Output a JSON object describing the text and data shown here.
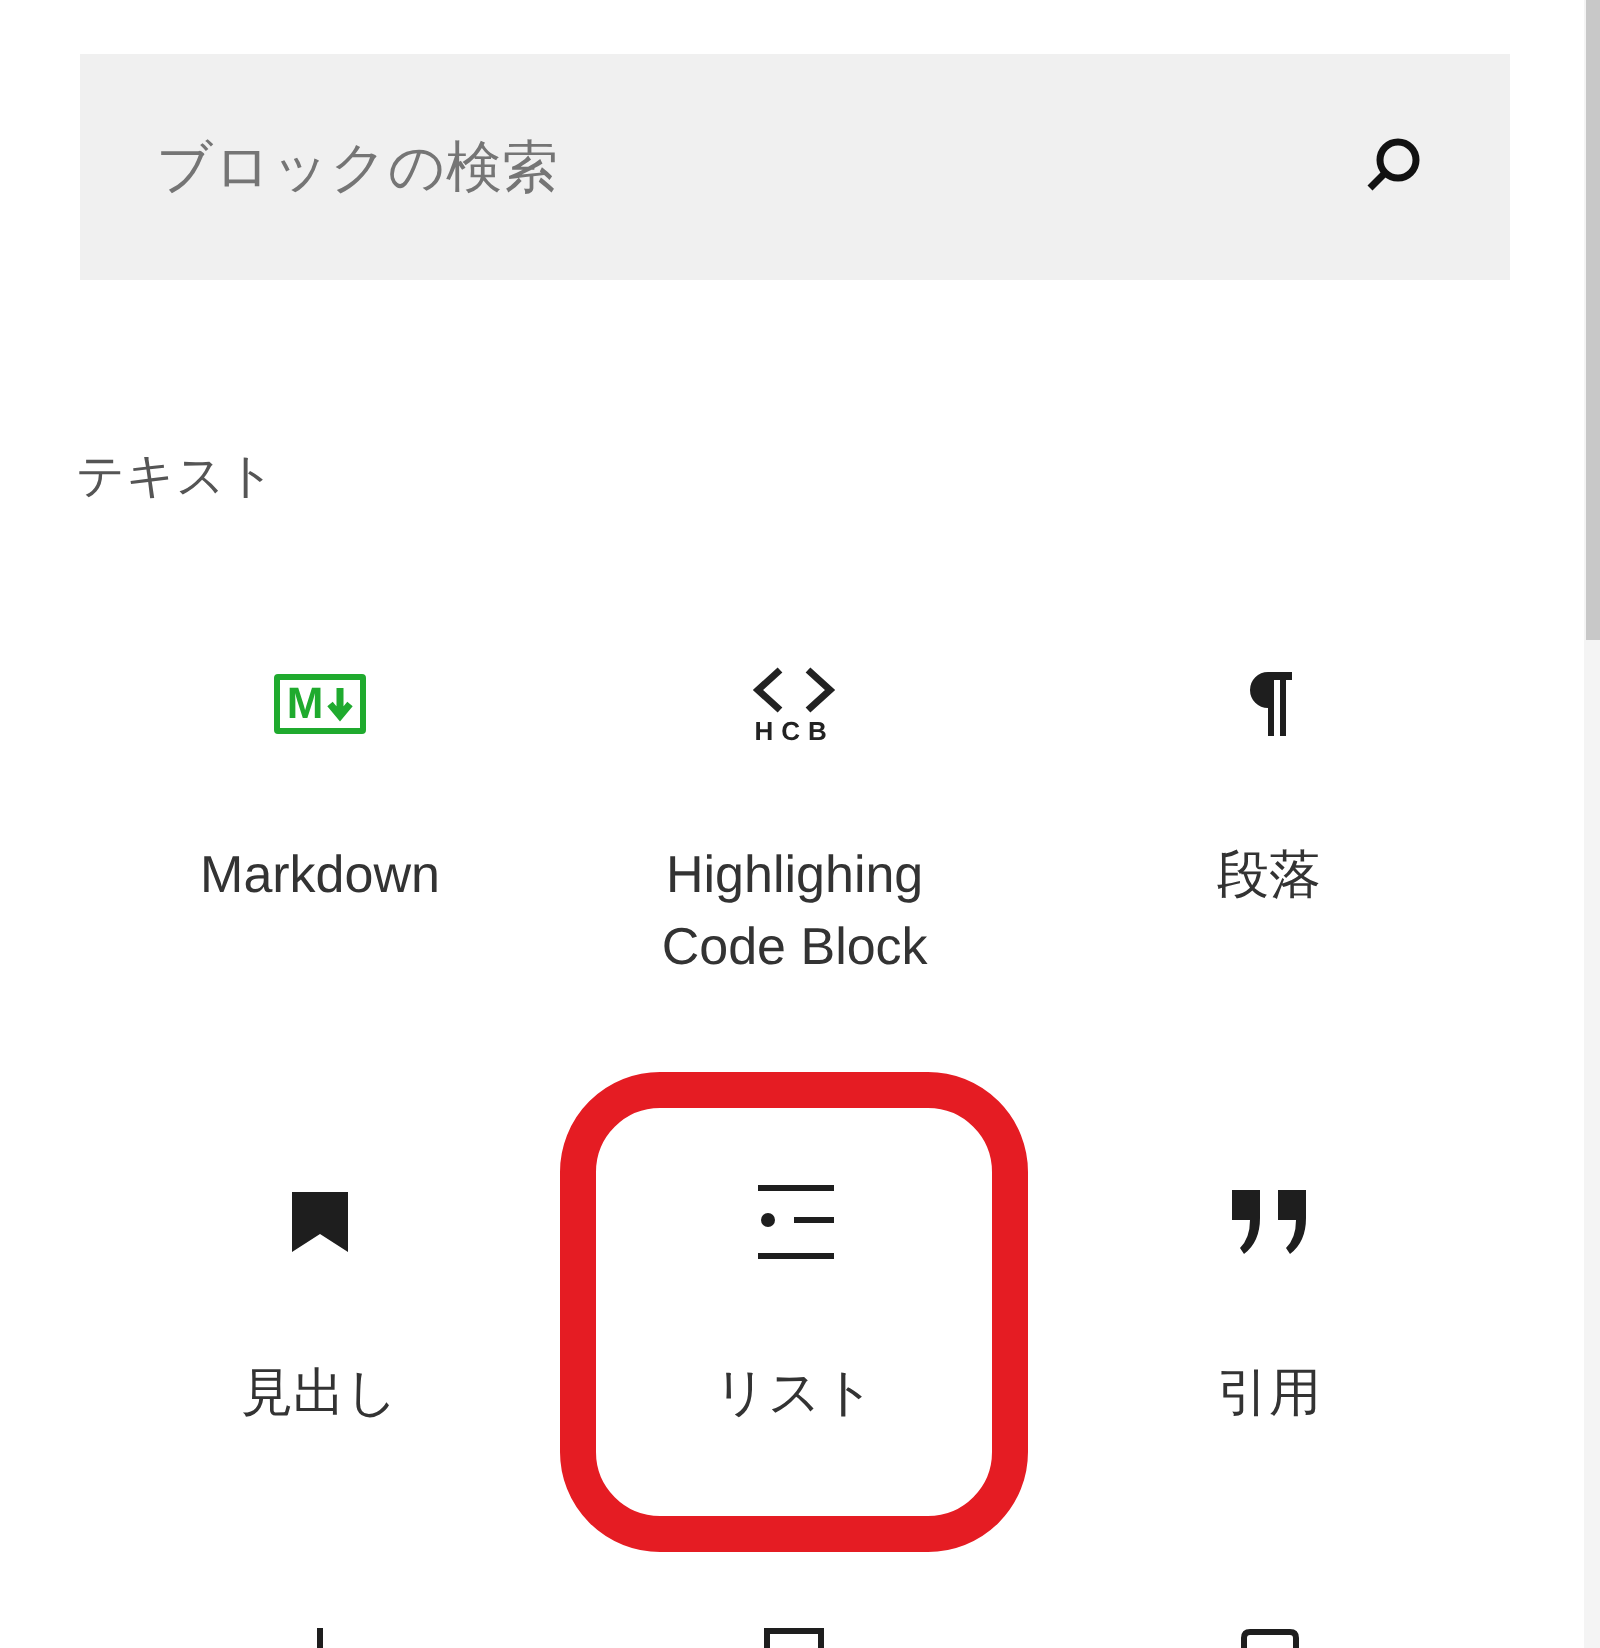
{
  "search": {
    "placeholder": "ブロックの検索"
  },
  "category": {
    "title": "テキスト"
  },
  "blocks": [
    {
      "kind": "markdown",
      "icon_text": "M",
      "label": "Markdown",
      "highlighted": false
    },
    {
      "kind": "hcb",
      "icon_text": "HCB",
      "label": "Highlighing Code Block",
      "highlighted": false
    },
    {
      "kind": "pilcrow",
      "label": "段落",
      "highlighted": false
    },
    {
      "kind": "bookmark",
      "label": "見出し",
      "highlighted": false
    },
    {
      "kind": "list",
      "label": "リスト",
      "highlighted": true
    },
    {
      "kind": "quote",
      "label": "引用",
      "highlighted": false
    },
    {
      "kind": "stem",
      "highlighted": false
    },
    {
      "kind": "bar",
      "highlighted": false
    },
    {
      "kind": "frame",
      "highlighted": false
    }
  ]
}
